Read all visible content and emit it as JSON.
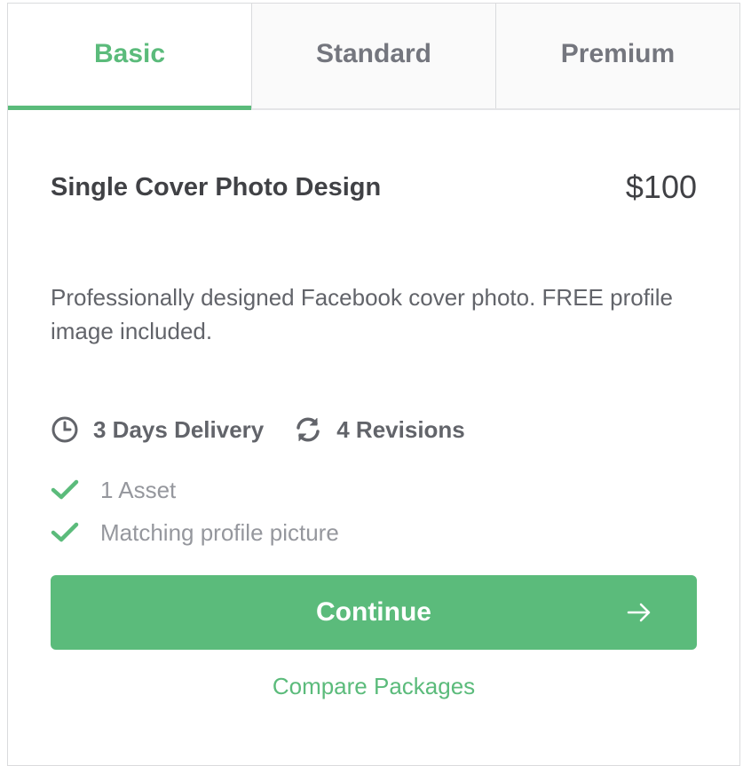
{
  "tabs": [
    "Basic",
    "Standard",
    "Premium"
  ],
  "package": {
    "title": "Single Cover Photo Design",
    "price": "$100",
    "description": "Professionally designed Facebook cover photo.  FREE profile image included.",
    "delivery": "3 Days Delivery",
    "revisions": "4 Revisions",
    "features": [
      "1 Asset",
      "Matching profile picture"
    ]
  },
  "actions": {
    "continue_label": "Continue",
    "compare_label": "Compare Packages"
  },
  "colors": {
    "accent": "#5bbb7b",
    "text": "#404145",
    "muted": "#95979d"
  },
  "icons": {
    "delivery": "clock-icon",
    "revisions": "refresh-icon",
    "feature": "checkmark-icon",
    "continue": "arrow-right-icon"
  }
}
